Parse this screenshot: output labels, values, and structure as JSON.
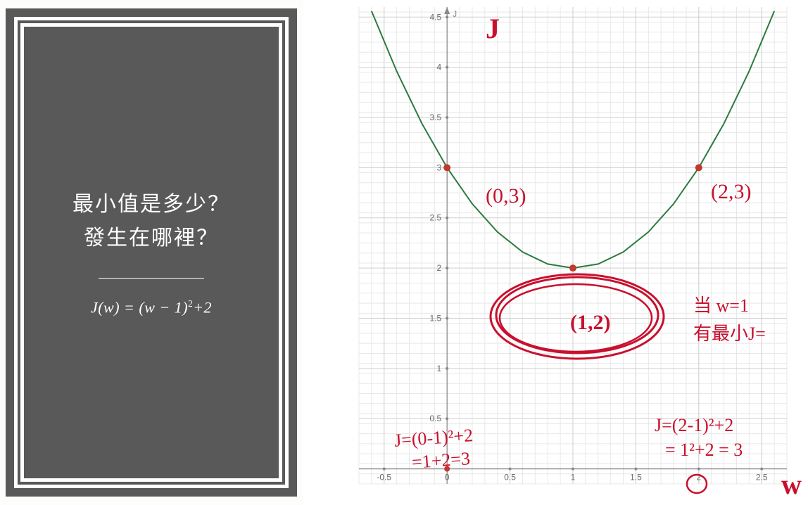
{
  "card": {
    "line1": "最小值是多少？",
    "line2": "發生在哪裡？",
    "formula_plain": "J(w) = (w − 1)² + 2"
  },
  "annotations": {
    "J_label": "J",
    "p03": "(0,3)",
    "p23": "(2,3)",
    "p12": "(1,2)",
    "when_w": "当 w=1",
    "has_minJ": "有最小J=",
    "calc_left_l1": "J=(0-1)²+2",
    "calc_left_l2": "=1+2=3",
    "calc_right_l1": "J=(2-1)²+2",
    "calc_right_l2": "= 1²+2 = 3",
    "w_axis": "w"
  },
  "chart_data": {
    "type": "line",
    "title": "",
    "xlabel": "w",
    "ylabel": "J",
    "xlim": [
      -0.7,
      2.7
    ],
    "ylim": [
      -0.15,
      4.6
    ],
    "series": [
      {
        "name": "J(w)=(w-1)^2+2",
        "x": [
          -0.6,
          -0.4,
          -0.2,
          0,
          0.2,
          0.4,
          0.6,
          0.8,
          1.0,
          1.2,
          1.4,
          1.6,
          1.8,
          2.0,
          2.2,
          2.4,
          2.6
        ],
        "y": [
          4.56,
          3.96,
          3.44,
          3.0,
          2.64,
          2.36,
          2.16,
          2.04,
          2.0,
          2.04,
          2.16,
          2.36,
          2.64,
          3.0,
          3.44,
          3.96,
          4.56
        ]
      }
    ],
    "points": [
      {
        "x": 0,
        "y": 3,
        "label": "(0,3)"
      },
      {
        "x": 1,
        "y": 2,
        "label": "(1,2)"
      },
      {
        "x": 2,
        "y": 3,
        "label": "(2,3)"
      }
    ],
    "x_ticks": [
      -0.5,
      0,
      0.5,
      1,
      1.5,
      2,
      2.5
    ],
    "y_ticks": [
      0.5,
      1,
      1.5,
      2,
      2.5,
      3,
      3.5,
      4,
      4.5
    ]
  }
}
